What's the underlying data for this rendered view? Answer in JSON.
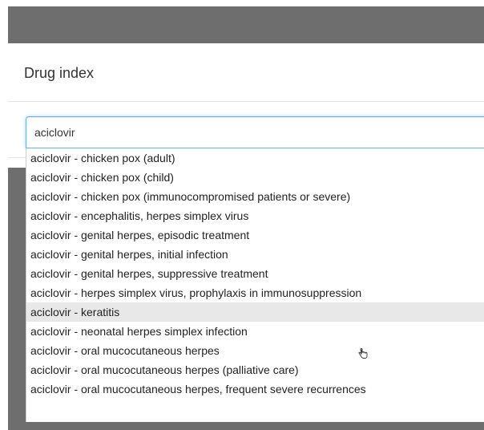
{
  "modal": {
    "title": "Drug index"
  },
  "search": {
    "value": "aciclovir"
  },
  "dropdown": {
    "active_index": 8,
    "items": [
      "aciclovir - chicken pox (adult)",
      "aciclovir - chicken pox (child)",
      "aciclovir - chicken pox (immunocompromised patients or severe)",
      "aciclovir - encephalitis, herpes simplex virus",
      "aciclovir - genital herpes, episodic treatment",
      "aciclovir - genital herpes, initial infection",
      "aciclovir - genital herpes, suppressive treatment",
      "aciclovir - herpes simplex virus, prophylaxis in immunosuppression",
      "aciclovir - keratitis",
      "aciclovir - neonatal herpes simplex infection",
      "aciclovir - oral mucocutaneous herpes",
      "aciclovir - oral mucocutaneous herpes (palliative care)",
      "aciclovir - oral mucocutaneous herpes, frequent severe recurrences"
    ]
  },
  "colors": {
    "backdrop": "#6e6e6e",
    "focus_border": "#66afe9",
    "active_item": "#e8e8e8"
  },
  "icons": {
    "cursor": "hand-pointer-icon"
  }
}
